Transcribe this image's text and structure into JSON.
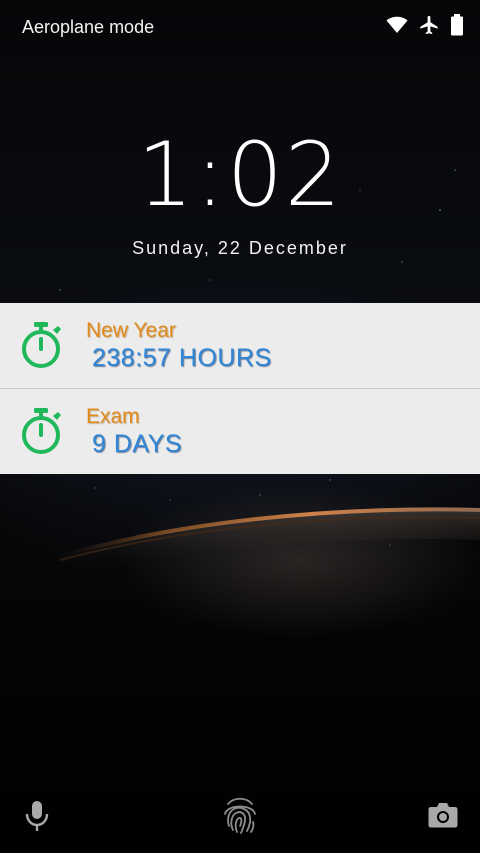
{
  "status_bar": {
    "mode_text": "Aeroplane mode",
    "icons": [
      "wifi-icon",
      "airplane-icon",
      "battery-icon"
    ]
  },
  "lock_screen": {
    "time": "1:02",
    "date": "Sunday, 22 December"
  },
  "notifications": [
    {
      "icon": "stopwatch-icon",
      "title": "New Year",
      "value": "238:57 HOURS"
    },
    {
      "icon": "stopwatch-icon",
      "title": "Exam",
      "value": "9 DAYS"
    }
  ],
  "bottom_shortcuts": {
    "left": "microphone-icon",
    "center": "fingerprint-icon",
    "right": "camera-icon"
  },
  "colors": {
    "notification_bg": "#ececec",
    "title_orange": "#e08a1c",
    "value_blue": "#2f86d6",
    "icon_green": "#1fb85a"
  }
}
